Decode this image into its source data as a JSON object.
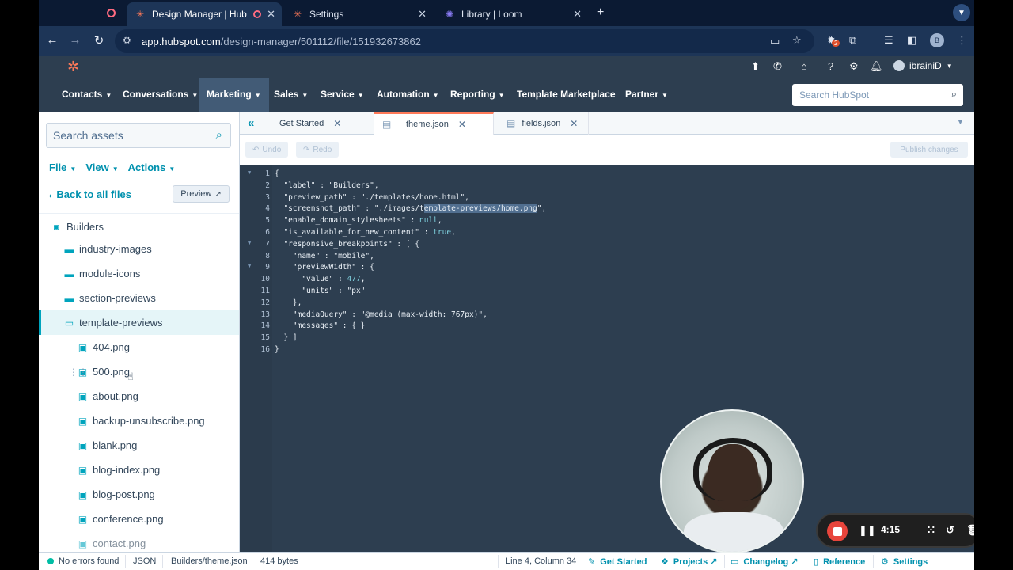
{
  "browser": {
    "tabs": [
      {
        "title": "Design Manager | HubSpot",
        "active": true
      },
      {
        "title": "Settings",
        "active": false
      },
      {
        "title": "Library | Loom",
        "active": false
      }
    ],
    "url_host": "app.hubspot.com",
    "url_path": "/design-manager/501112/file/151932673862",
    "extension_badge": "2",
    "profile_initial": "B"
  },
  "hubspot": {
    "user_name": "ibrainiD",
    "nav": [
      "Contacts",
      "Conversations",
      "Marketing",
      "Sales",
      "Service",
      "Automation",
      "Reporting",
      "Template Marketplace",
      "Partner"
    ],
    "search_placeholder": "Search HubSpot"
  },
  "sidebar": {
    "search_placeholder": "Search assets",
    "menu": [
      "File",
      "View",
      "Actions"
    ],
    "back_link": "Back to all files",
    "preview_label": "Preview",
    "root": "Builders",
    "folders": [
      "industry-images",
      "module-icons",
      "section-previews",
      "template-previews"
    ],
    "files": [
      "404.png",
      "500.png",
      "about.png",
      "backup-unsubscribe.png",
      "blank.png",
      "blog-index.png",
      "blog-post.png",
      "conference.png",
      "contact.png"
    ]
  },
  "editor": {
    "tabs": [
      "Get Started",
      "theme.json",
      "fields.json"
    ],
    "undo_label": "Undo",
    "redo_label": "Redo",
    "publish_label": "Publish changes",
    "lines": [
      "{",
      "  \"label\" : \"Builders\",",
      "  \"preview_path\" : \"./templates/home.html\",",
      "  \"screenshot_path\" : \"./images/template-previews/home.png\",",
      "  \"enable_domain_stylesheets\" : null,",
      "  \"is_available_for_new_content\" : true,",
      "  \"responsive_breakpoints\" : [ {",
      "    \"name\" : \"mobile\",",
      "    \"previewWidth\" : {",
      "      \"value\" : 477,",
      "      \"units\" : \"px\"",
      "    },",
      "    \"mediaQuery\" : \"@media (max-width: 767px)\",",
      "    \"messages\" : { }",
      "  } ]",
      "}"
    ]
  },
  "status": {
    "errors": "No errors found",
    "language": "JSON",
    "path": "Builders/theme.json",
    "size": "414 bytes",
    "cursor": "Line 4, Column 34",
    "get_started": "Get Started",
    "projects": "Projects",
    "changelog": "Changelog",
    "reference": "Reference",
    "settings": "Settings"
  },
  "loom": {
    "timer": "4:15"
  }
}
